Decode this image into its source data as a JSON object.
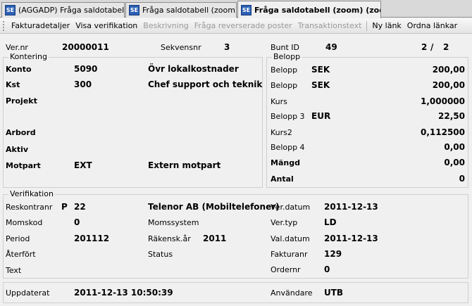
{
  "tabs": [
    {
      "label": "(AGGADP) Fråga saldotabell",
      "icon": "SE"
    },
    {
      "label": "Fråga saldotabell (zoom)",
      "icon": "SE"
    },
    {
      "label": "Fråga saldotabell (zoom) (zoom)",
      "icon": "SE"
    }
  ],
  "toolbar": {
    "items": [
      {
        "label": "Fakturadetaljer",
        "enabled": true
      },
      {
        "label": "Visa verifikation",
        "enabled": true
      },
      {
        "label": "Beskrivning",
        "enabled": false
      },
      {
        "label": "Fråga reverserade poster",
        "enabled": false
      },
      {
        "label": "Transaktionstext",
        "enabled": false
      },
      {
        "label": "Ny länk",
        "enabled": true
      },
      {
        "label": "Ordna länkar",
        "enabled": true
      }
    ]
  },
  "header": {
    "vernr_label": "Ver.nr",
    "vernr_value": "20000011",
    "sekvensnr_label": "Sekvensnr",
    "sekvensnr_value": "3",
    "buntid_label": "Bunt ID",
    "buntid_value": "49",
    "page_current": "2",
    "page_sep": "/",
    "page_total": "2"
  },
  "kontering": {
    "title": "Kontering",
    "konto_label": "Konto",
    "konto_value": "5090",
    "konto_desc": "Övr lokalkostnader",
    "kst_label": "Kst",
    "kst_value": "300",
    "kst_desc": "Chef support och teknik",
    "projekt_label": "Projekt",
    "arbord_label": "Arbord",
    "aktiv_label": "Aktiv",
    "motpart_label": "Motpart",
    "motpart_value": "EXT",
    "motpart_desc": "Extern motpart"
  },
  "belopp": {
    "title": "Belopp",
    "rows": [
      {
        "label": "Belopp",
        "currency": "SEK",
        "value": "200,00"
      },
      {
        "label": "Belopp",
        "currency": "SEK",
        "value": "200,00"
      },
      {
        "label": "Kurs",
        "currency": "",
        "value": "1,000000"
      },
      {
        "label": "Belopp 3",
        "currency": "EUR",
        "value": "22,50"
      },
      {
        "label": "Kurs2",
        "currency": "",
        "value": "0,112500"
      },
      {
        "label": "Belopp 4",
        "currency": "",
        "value": "0,00"
      },
      {
        "label": "Mängd",
        "currency": "",
        "value": "0,00"
      },
      {
        "label": "Antal",
        "currency": "",
        "value": "0"
      }
    ]
  },
  "verifikation": {
    "title": "Verifikation",
    "reskontranr_label": "Reskontranr",
    "reskontranr_type": "P",
    "reskontranr_value": "22",
    "reskontranr_desc": "Telenor AB (Mobiltelefoner)",
    "momskod_label": "Momskod",
    "momskod_value": "0",
    "momssystem_label": "Momssystem",
    "period_label": "Period",
    "period_value": "201112",
    "rakenskar_label": "Räkensk.år",
    "rakenskar_value": "2011",
    "aterfort_label": "Återfört",
    "status_label": "Status",
    "text_label": "Text",
    "verdatum_label": "Ver.datum",
    "verdatum_value": "2011-12-13",
    "vertyp_label": "Ver.typ",
    "vertyp_value": "LD",
    "valdatum_label": "Val.datum",
    "valdatum_value": "2011-12-13",
    "fakturanr_label": "Fakturanr",
    "fakturanr_value": "129",
    "ordernr_label": "Ordernr",
    "ordernr_value": "0"
  },
  "footer": {
    "uppdaterat_label": "Uppdaterat",
    "uppdaterat_value": "2011-12-13 10:50:39",
    "anvandare_label": "Användare",
    "anvandare_value": "UTB"
  }
}
